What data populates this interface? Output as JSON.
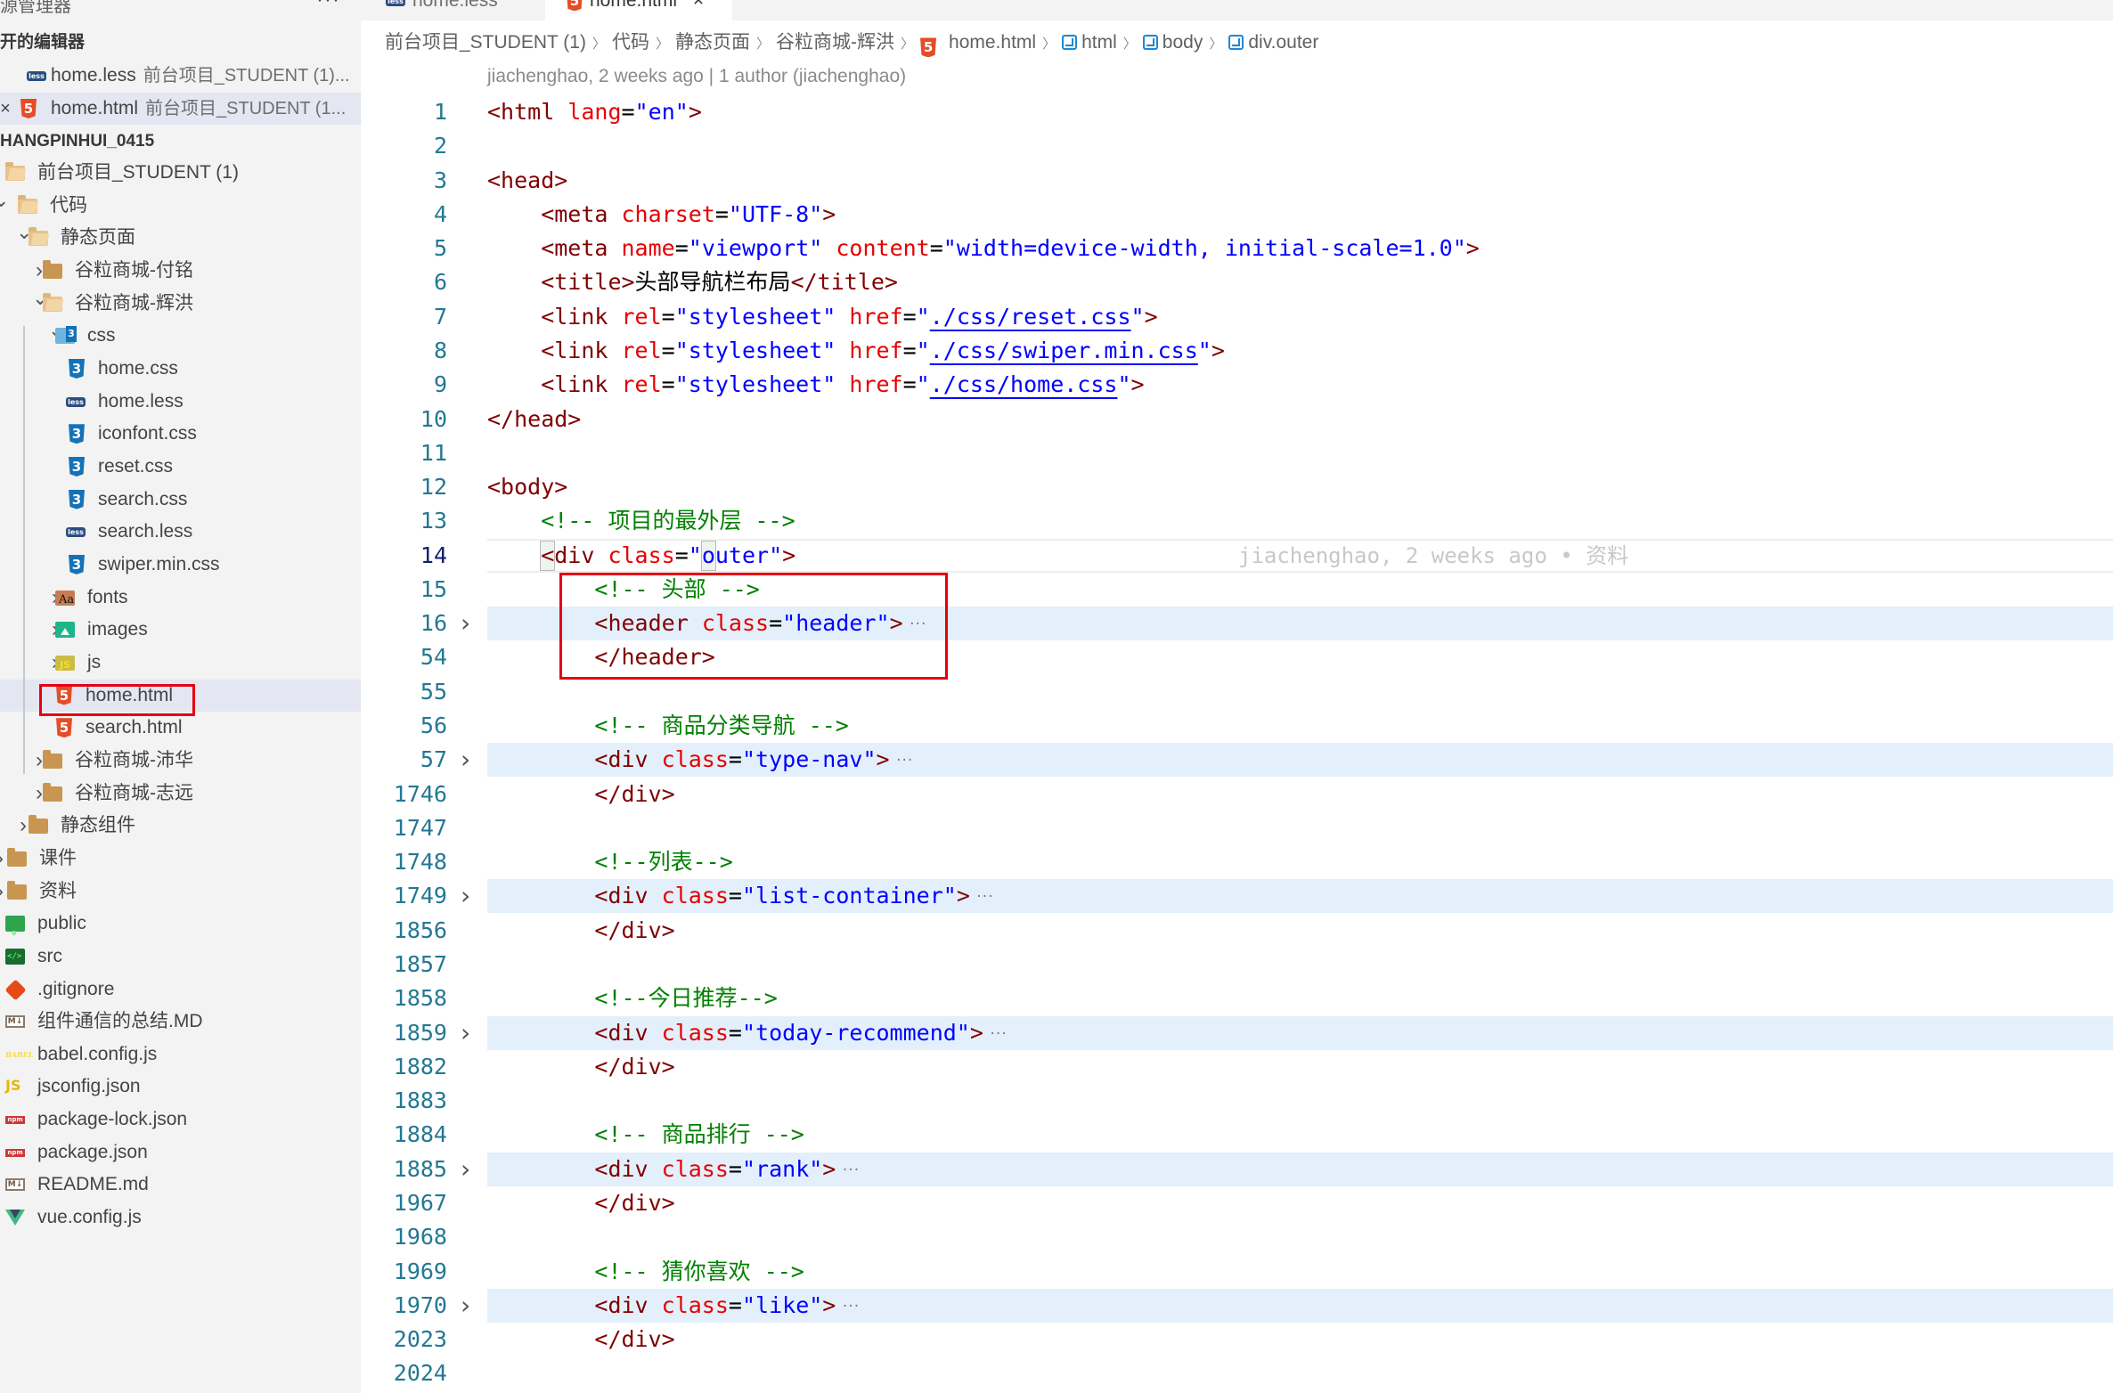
{
  "sidebar": {
    "title": "源管理器",
    "more_icon": "ellipsis-icon",
    "open_editors": {
      "header": "开的编辑器",
      "items": [
        {
          "icon": "less-file-icon",
          "name": "home.less",
          "desc": "前台项目_STUDENT (1)..."
        },
        {
          "icon": "html5-file-icon",
          "name": "home.html",
          "desc": "前台项目_STUDENT (1...",
          "close_icon": "×",
          "selected": true
        }
      ]
    },
    "workspace": {
      "header": "HANGPINHUI_0415",
      "tree": [
        {
          "label": "前台项目_STUDENT (1)",
          "icon": "folder-open-icon",
          "chevron": "",
          "depth": 0
        },
        {
          "label": "代码",
          "icon": "folder-open-icon",
          "chevron": "v",
          "depth": 0
        },
        {
          "label": "静态页面",
          "icon": "folder-open-icon",
          "chevron": "v",
          "depth": 1
        },
        {
          "label": "谷粒商城-付铭",
          "icon": "folder-icon",
          "chevron": ">",
          "depth": 2
        },
        {
          "label": "谷粒商城-辉洪",
          "icon": "folder-open-icon",
          "chevron": "v",
          "depth": 2
        },
        {
          "label": "css",
          "icon": "css-folder-icon",
          "chevron": "v",
          "depth": 3
        },
        {
          "label": "home.css",
          "icon": "css3-file-icon",
          "chevron": "",
          "depth": 4
        },
        {
          "label": "home.less",
          "icon": "less-file-icon",
          "chevron": "",
          "depth": 4
        },
        {
          "label": "iconfont.css",
          "icon": "css3-file-icon",
          "chevron": "",
          "depth": 4
        },
        {
          "label": "reset.css",
          "icon": "css3-file-icon",
          "chevron": "",
          "depth": 4
        },
        {
          "label": "search.css",
          "icon": "css3-file-icon",
          "chevron": "",
          "depth": 4
        },
        {
          "label": "search.less",
          "icon": "less-file-icon",
          "chevron": "",
          "depth": 4
        },
        {
          "label": "swiper.min.css",
          "icon": "css3-file-icon",
          "chevron": "",
          "depth": 4
        },
        {
          "label": "fonts",
          "icon": "fonts-folder-icon",
          "chevron": ">",
          "depth": 3
        },
        {
          "label": "images",
          "icon": "images-folder-icon",
          "chevron": ">",
          "depth": 3
        },
        {
          "label": "js",
          "icon": "js-folder-icon",
          "chevron": ">",
          "depth": 3
        },
        {
          "label": "home.html",
          "icon": "html5-file-icon",
          "chevron": "",
          "depth": 3,
          "selected": true
        },
        {
          "label": "search.html",
          "icon": "html5-file-icon",
          "chevron": "",
          "depth": 3
        },
        {
          "label": "谷粒商城-沛华",
          "icon": "folder-icon",
          "chevron": ">",
          "depth": 2
        },
        {
          "label": "谷粒商城-志远",
          "icon": "folder-icon",
          "chevron": ">",
          "depth": 2
        },
        {
          "label": "静态组件",
          "icon": "folder-icon",
          "chevron": ">",
          "depth": 1
        },
        {
          "label": "课件",
          "icon": "folder-icon",
          "chevron": ">",
          "depth": 0
        },
        {
          "label": "资料",
          "icon": "folder-icon",
          "chevron": ">",
          "depth": 0
        },
        {
          "label": "public",
          "icon": "public-folder-icon",
          "chevron": "",
          "depth": -1
        },
        {
          "label": "src",
          "icon": "src-folder-icon",
          "chevron": "",
          "depth": -1
        },
        {
          "label": ".gitignore",
          "icon": "git-icon",
          "chevron": "",
          "depth": -1
        },
        {
          "label": "组件通信的总结.MD",
          "icon": "markdown-icon",
          "chevron": "",
          "depth": -1
        },
        {
          "label": "babel.config.js",
          "icon": "babel-icon",
          "chevron": "",
          "depth": -1
        },
        {
          "label": "jsconfig.json",
          "icon": "js-config-icon",
          "chevron": "",
          "depth": -1
        },
        {
          "label": "package-lock.json",
          "icon": "npm-icon",
          "chevron": "",
          "depth": -1
        },
        {
          "label": "package.json",
          "icon": "npm-icon",
          "chevron": "",
          "depth": -1
        },
        {
          "label": "README.md",
          "icon": "markdown-icon",
          "chevron": "",
          "depth": -1
        },
        {
          "label": "vue.config.js",
          "icon": "vue-icon",
          "chevron": "",
          "depth": -1
        }
      ]
    }
  },
  "tabs": [
    {
      "label": "home.less",
      "icon": "less-file-icon",
      "active": false
    },
    {
      "label": "home.html",
      "icon": "html5-file-icon",
      "active": true,
      "close": "×"
    }
  ],
  "breadcrumb": [
    {
      "label": "前台项目_STUDENT (1)",
      "icon": ""
    },
    {
      "label": "代码",
      "icon": ""
    },
    {
      "label": "静态页面",
      "icon": ""
    },
    {
      "label": "谷粒商城-辉洪",
      "icon": ""
    },
    {
      "label": "home.html",
      "icon": "html5-file-icon"
    },
    {
      "label": "html",
      "icon": "symbol-cube-icon"
    },
    {
      "label": "body",
      "icon": "symbol-cube-icon"
    },
    {
      "label": "div.outer",
      "icon": "symbol-cube-icon"
    }
  ],
  "editor": {
    "blame_header": "jiachenghao, 2 weeks ago | 1 author (jiachenghao)",
    "inline_blame": "jiachenghao, 2 weeks ago • 资料",
    "current_line": 14,
    "lines": [
      {
        "n": "1",
        "indent": 0,
        "tokens": [
          [
            "tag",
            "<html "
          ],
          [
            "attr",
            "lang"
          ],
          [
            "eq",
            "="
          ],
          [
            "str",
            "\"en\""
          ],
          [
            "tag",
            ">"
          ]
        ]
      },
      {
        "n": "2",
        "indent": 0,
        "tokens": []
      },
      {
        "n": "3",
        "indent": 0,
        "tokens": [
          [
            "tag",
            "<head>"
          ]
        ]
      },
      {
        "n": "4",
        "indent": 1,
        "tokens": [
          [
            "tag",
            "<meta "
          ],
          [
            "attr",
            "charset"
          ],
          [
            "eq",
            "="
          ],
          [
            "str",
            "\"UTF-8\""
          ],
          [
            "tag",
            ">"
          ]
        ]
      },
      {
        "n": "5",
        "indent": 1,
        "tokens": [
          [
            "tag",
            "<meta "
          ],
          [
            "attr",
            "name"
          ],
          [
            "eq",
            "="
          ],
          [
            "str",
            "\"viewport\" "
          ],
          [
            "attr",
            "content"
          ],
          [
            "eq",
            "="
          ],
          [
            "str",
            "\"width=device-width, initial-scale=1.0\""
          ],
          [
            "tag",
            ">"
          ]
        ]
      },
      {
        "n": "6",
        "indent": 1,
        "tokens": [
          [
            "tag",
            "<title>"
          ],
          [
            "txt",
            "头部导航栏布局"
          ],
          [
            "tag",
            "</title>"
          ]
        ]
      },
      {
        "n": "7",
        "indent": 1,
        "tokens": [
          [
            "tag",
            "<link "
          ],
          [
            "attr",
            "rel"
          ],
          [
            "eq",
            "="
          ],
          [
            "str",
            "\"stylesheet\" "
          ],
          [
            "attr",
            "href"
          ],
          [
            "eq",
            "="
          ],
          [
            "str",
            "\""
          ],
          [
            "link",
            "./css/reset.css"
          ],
          [
            "str",
            "\""
          ],
          [
            "tag",
            ">"
          ]
        ]
      },
      {
        "n": "8",
        "indent": 1,
        "tokens": [
          [
            "tag",
            "<link "
          ],
          [
            "attr",
            "rel"
          ],
          [
            "eq",
            "="
          ],
          [
            "str",
            "\"stylesheet\" "
          ],
          [
            "attr",
            "href"
          ],
          [
            "eq",
            "="
          ],
          [
            "str",
            "\""
          ],
          [
            "link",
            "./css/swiper.min.css"
          ],
          [
            "str",
            "\""
          ],
          [
            "tag",
            ">"
          ]
        ]
      },
      {
        "n": "9",
        "indent": 1,
        "tokens": [
          [
            "tag",
            "<link "
          ],
          [
            "attr",
            "rel"
          ],
          [
            "eq",
            "="
          ],
          [
            "str",
            "\"stylesheet\" "
          ],
          [
            "attr",
            "href"
          ],
          [
            "eq",
            "="
          ],
          [
            "str",
            "\""
          ],
          [
            "link",
            "./css/home.css"
          ],
          [
            "str",
            "\""
          ],
          [
            "tag",
            ">"
          ]
        ]
      },
      {
        "n": "10",
        "indent": 0,
        "tokens": [
          [
            "tag",
            "</head>"
          ]
        ]
      },
      {
        "n": "11",
        "indent": 0,
        "tokens": []
      },
      {
        "n": "12",
        "indent": 0,
        "tokens": [
          [
            "tag",
            "<body>"
          ]
        ]
      },
      {
        "n": "13",
        "indent": 1,
        "tokens": [
          [
            "cmt",
            "<!-- 项目的最外层 -->"
          ]
        ]
      },
      {
        "n": "14",
        "indent": 1,
        "tokens": [
          [
            "tag",
            "<div "
          ],
          [
            "attr",
            "class"
          ],
          [
            "eq",
            "="
          ],
          [
            "str",
            "\"outer\""
          ],
          [
            "tag",
            ">"
          ]
        ],
        "current": true
      },
      {
        "n": "15",
        "indent": 2,
        "tokens": [
          [
            "cmt",
            "<!-- 头部 -->"
          ]
        ]
      },
      {
        "n": "16",
        "indent": 2,
        "tokens": [
          [
            "tag",
            "<header "
          ],
          [
            "attr",
            "class"
          ],
          [
            "eq",
            "="
          ],
          [
            "str",
            "\"header\""
          ],
          [
            "tag",
            ">"
          ]
        ],
        "folded": true
      },
      {
        "n": "54",
        "indent": 2,
        "tokens": [
          [
            "tag",
            "</header>"
          ]
        ]
      },
      {
        "n": "55",
        "indent": 0,
        "tokens": []
      },
      {
        "n": "56",
        "indent": 2,
        "tokens": [
          [
            "cmt",
            "<!-- 商品分类导航 -->"
          ]
        ]
      },
      {
        "n": "57",
        "indent": 2,
        "tokens": [
          [
            "tag",
            "<div "
          ],
          [
            "attr",
            "class"
          ],
          [
            "eq",
            "="
          ],
          [
            "str",
            "\"type-nav\""
          ],
          [
            "tag",
            ">"
          ]
        ],
        "folded": true
      },
      {
        "n": "1746",
        "indent": 2,
        "tokens": [
          [
            "tag",
            "</div>"
          ]
        ]
      },
      {
        "n": "1747",
        "indent": 0,
        "tokens": []
      },
      {
        "n": "1748",
        "indent": 2,
        "tokens": [
          [
            "cmt",
            "<!--列表-->"
          ]
        ]
      },
      {
        "n": "1749",
        "indent": 2,
        "tokens": [
          [
            "tag",
            "<div "
          ],
          [
            "attr",
            "class"
          ],
          [
            "eq",
            "="
          ],
          [
            "str",
            "\"list-container\""
          ],
          [
            "tag",
            ">"
          ]
        ],
        "folded": true
      },
      {
        "n": "1856",
        "indent": 2,
        "tokens": [
          [
            "tag",
            "</div>"
          ]
        ]
      },
      {
        "n": "1857",
        "indent": 0,
        "tokens": []
      },
      {
        "n": "1858",
        "indent": 2,
        "tokens": [
          [
            "cmt",
            "<!--今日推荐-->"
          ]
        ]
      },
      {
        "n": "1859",
        "indent": 2,
        "tokens": [
          [
            "tag",
            "<div "
          ],
          [
            "attr",
            "class"
          ],
          [
            "eq",
            "="
          ],
          [
            "str",
            "\"today-recommend\""
          ],
          [
            "tag",
            ">"
          ]
        ],
        "folded": true
      },
      {
        "n": "1882",
        "indent": 2,
        "tokens": [
          [
            "tag",
            "</div>"
          ]
        ]
      },
      {
        "n": "1883",
        "indent": 0,
        "tokens": []
      },
      {
        "n": "1884",
        "indent": 2,
        "tokens": [
          [
            "cmt",
            "<!-- 商品排行 -->"
          ]
        ]
      },
      {
        "n": "1885",
        "indent": 2,
        "tokens": [
          [
            "tag",
            "<div "
          ],
          [
            "attr",
            "class"
          ],
          [
            "eq",
            "="
          ],
          [
            "str",
            "\"rank\""
          ],
          [
            "tag",
            ">"
          ]
        ],
        "folded": true
      },
      {
        "n": "1967",
        "indent": 2,
        "tokens": [
          [
            "tag",
            "</div>"
          ]
        ]
      },
      {
        "n": "1968",
        "indent": 0,
        "tokens": []
      },
      {
        "n": "1969",
        "indent": 2,
        "tokens": [
          [
            "cmt",
            "<!-- 猜你喜欢 -->"
          ]
        ]
      },
      {
        "n": "1970",
        "indent": 2,
        "tokens": [
          [
            "tag",
            "<div "
          ],
          [
            "attr",
            "class"
          ],
          [
            "eq",
            "="
          ],
          [
            "str",
            "\"like\""
          ],
          [
            "tag",
            ">"
          ]
        ],
        "folded": true
      },
      {
        "n": "2023",
        "indent": 2,
        "tokens": [
          [
            "tag",
            "</div>"
          ]
        ]
      },
      {
        "n": "2024",
        "indent": 0,
        "tokens": []
      }
    ],
    "fold_chevron": ">",
    "fold_ellipsis": "···"
  },
  "annotations": {
    "highlight_color": "#e60012",
    "highlighted": [
      "sidebar home.html",
      "editor lines 15–54 (header block)"
    ]
  }
}
